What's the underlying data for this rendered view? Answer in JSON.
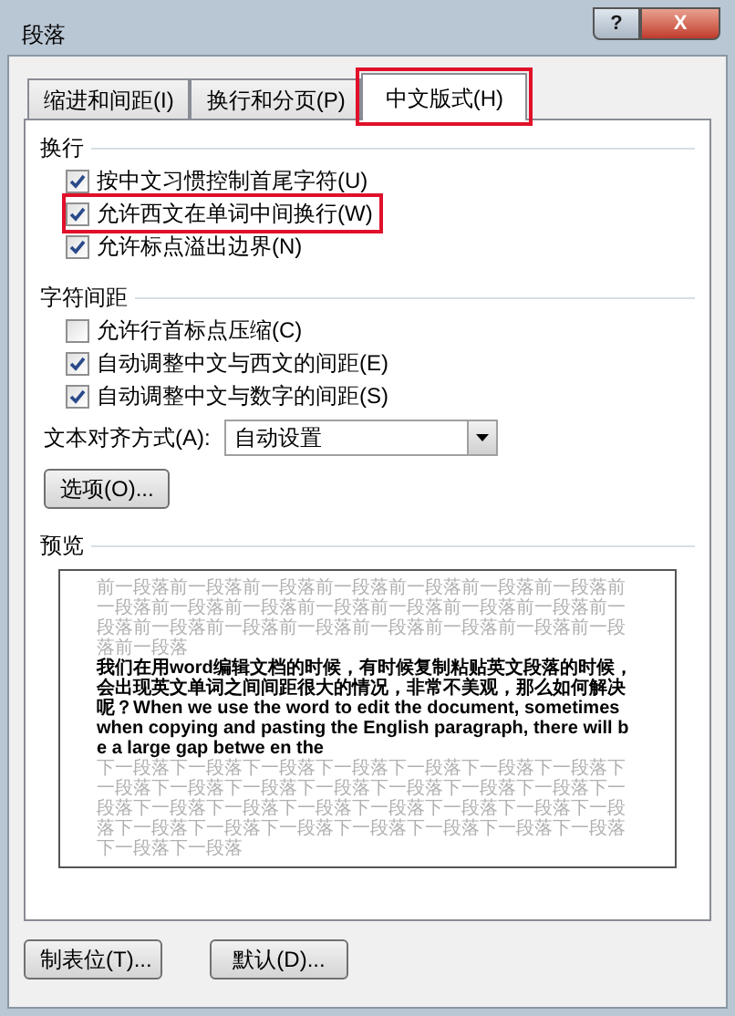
{
  "window": {
    "title": "段落",
    "buttons": [
      {
        "kind": "help",
        "label": "?"
      },
      {
        "kind": "close",
        "label": "X"
      }
    ]
  },
  "tabs": [
    {
      "label": "缩进和间距(I)",
      "selected": false,
      "highlighted": false
    },
    {
      "label": "换行和分页(P)",
      "selected": false,
      "highlighted": false
    },
    {
      "label": "中文版式(H)",
      "selected": true,
      "highlighted": true
    }
  ],
  "sections": [
    {
      "title": "换行",
      "options": [
        {
          "label": "按中文习惯控制首尾字符(U)",
          "checked": true,
          "highlighted": false
        },
        {
          "label": "允许西文在单词中间换行(W)",
          "checked": true,
          "highlighted": true
        },
        {
          "label": "允许标点溢出边界(N)",
          "checked": true,
          "highlighted": false
        }
      ]
    },
    {
      "title": "字符间距",
      "options": [
        {
          "label": "允许行首标点压缩(C)",
          "checked": false,
          "highlighted": false
        },
        {
          "label": "自动调整中文与西文的间距(E)",
          "checked": true,
          "highlighted": false
        },
        {
          "label": "自动调整中文与数字的间距(S)",
          "checked": true,
          "highlighted": false
        }
      ]
    }
  ],
  "alignment": {
    "label": "文本对齐方式(A):",
    "value": "自动设置"
  },
  "options_button": "选项(O)...",
  "preview": {
    "title": "预览",
    "previous": "前一段落前一段落前一段落前一段落前一段落前一段落前一段落前一段落前一段落前一段落前一段落前一段落前一段落前一段落前一段落前一段落前一段落前一段落前一段落前一段落前一段落前一段落前一段落",
    "sample": "我们在用word编辑文档的时候，有时候复制粘贴英文段落的时候，会出现英文单词之间间距很大的情况，非常不美观，那么如何解决呢？When we use the word to edit the document, sometimes when copying and pasting the English paragraph, there will be a large gap betwe en the",
    "next": "下一段落下一段落下一段落下一段落下一段落下一段落下一段落下一段落下一段落下一段落下一段落下一段落下一段落下一段落下一段落下一段落下一段落下一段落下一段落下一段落下一段落下一段落下一段落下一段落下一段落下一段落下一段落下一段落下一段落下一段落下一段落"
  },
  "footer_buttons": [
    "制表位(T)...",
    "默认(D)..."
  ]
}
